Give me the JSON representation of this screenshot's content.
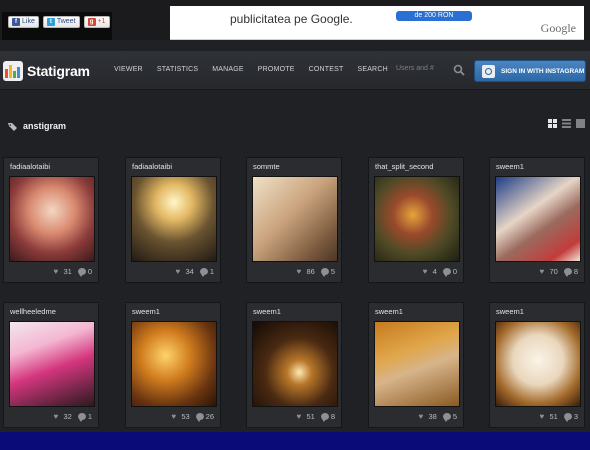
{
  "social": {
    "like": "Like",
    "tweet": "Tweet",
    "plusone": "+1"
  },
  "ad": {
    "text": "publicitatea pe Google.",
    "pill": "de 200 RON",
    "brand": "Google"
  },
  "nav": {
    "brand": "Statigram",
    "links": [
      "VIEWER",
      "STATISTICS",
      "MANAGE",
      "PROMOTE",
      "CONTEST",
      "SEARCH"
    ],
    "search_placeholder": "Users and #",
    "signin": "SIGN IN WITH INSTAGRAM"
  },
  "tag": {
    "label": "anstigram"
  },
  "photos": [
    {
      "user": "fadiaalotaibi",
      "likes": "31",
      "comments": "0"
    },
    {
      "user": "fadiaalotaibi",
      "likes": "34",
      "comments": "1"
    },
    {
      "user": "sommte",
      "likes": "86",
      "comments": "5"
    },
    {
      "user": "that_split_second",
      "likes": "4",
      "comments": "0"
    },
    {
      "user": "sweem1",
      "likes": "70",
      "comments": "8"
    },
    {
      "user": "wellheeledme",
      "likes": "32",
      "comments": "1"
    },
    {
      "user": "sweem1",
      "likes": "53",
      "comments": "26"
    },
    {
      "user": "sweem1",
      "likes": "51",
      "comments": "8"
    },
    {
      "user": "sweem1",
      "likes": "38",
      "comments": "5"
    },
    {
      "user": "sweem1",
      "likes": "51",
      "comments": "3"
    }
  ],
  "colors": {
    "page_bg": "#1f2124",
    "outer_border": "#0a0a78",
    "signin_blue": "#3a78b8"
  }
}
